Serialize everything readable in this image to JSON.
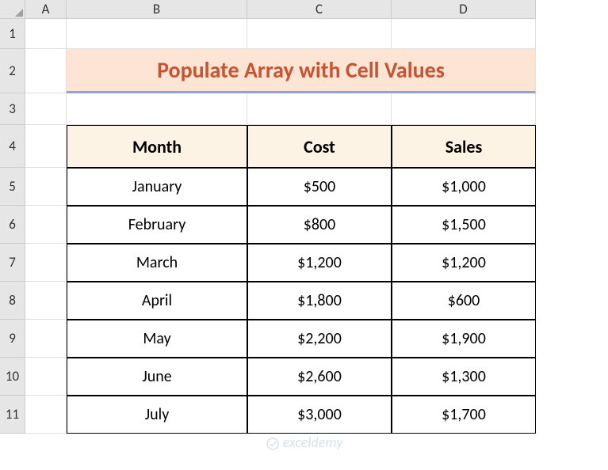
{
  "columns": [
    "A",
    "B",
    "C",
    "D"
  ],
  "rows": [
    "1",
    "2",
    "3",
    "4",
    "5",
    "6",
    "7",
    "8",
    "9",
    "10",
    "11"
  ],
  "title": "Populate Array with Cell Values",
  "headers": [
    "Month",
    "Cost",
    "Sales"
  ],
  "data": [
    {
      "month": "January",
      "cost": "$500",
      "sales": "$1,000"
    },
    {
      "month": "February",
      "cost": "$800",
      "sales": "$1,500"
    },
    {
      "month": "March",
      "cost": "$1,200",
      "sales": "$1,200"
    },
    {
      "month": "April",
      "cost": "$1,800",
      "sales": "$600"
    },
    {
      "month": "May",
      "cost": "$2,200",
      "sales": "$1,900"
    },
    {
      "month": "June",
      "cost": "$2,600",
      "sales": "$1,300"
    },
    {
      "month": "July",
      "cost": "$3,000",
      "sales": "$1,700"
    }
  ],
  "watermark": "exceldemy"
}
